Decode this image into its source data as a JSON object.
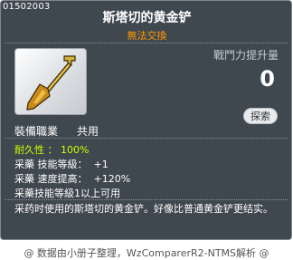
{
  "item": {
    "code": "01502003",
    "name": "斯塔切的黄金铲",
    "trade_status": "無法交換",
    "power_label": "戰鬥力提升量",
    "power_value": "0",
    "explore_button": "探索",
    "job_label": "裝備職業",
    "job_value": "共用",
    "stats": [
      "耐久性 ： 100%",
      "采藥 技能等級：  +1",
      "采藥 速度提高：  +120%",
      "采藥技能等級1以上可用"
    ],
    "description": "采药时使用的斯塔切的黄金铲。好像比普通黄金铲更结实。",
    "icon": "golden-shovel-icon"
  },
  "footer": "@ 数据由小册子整理，WzComparerR2-NTMS解析 @",
  "colors": {
    "background": "#3f474f",
    "trade_status": "#ff9900",
    "durability": "#ccff00",
    "text": "#ffffff"
  }
}
